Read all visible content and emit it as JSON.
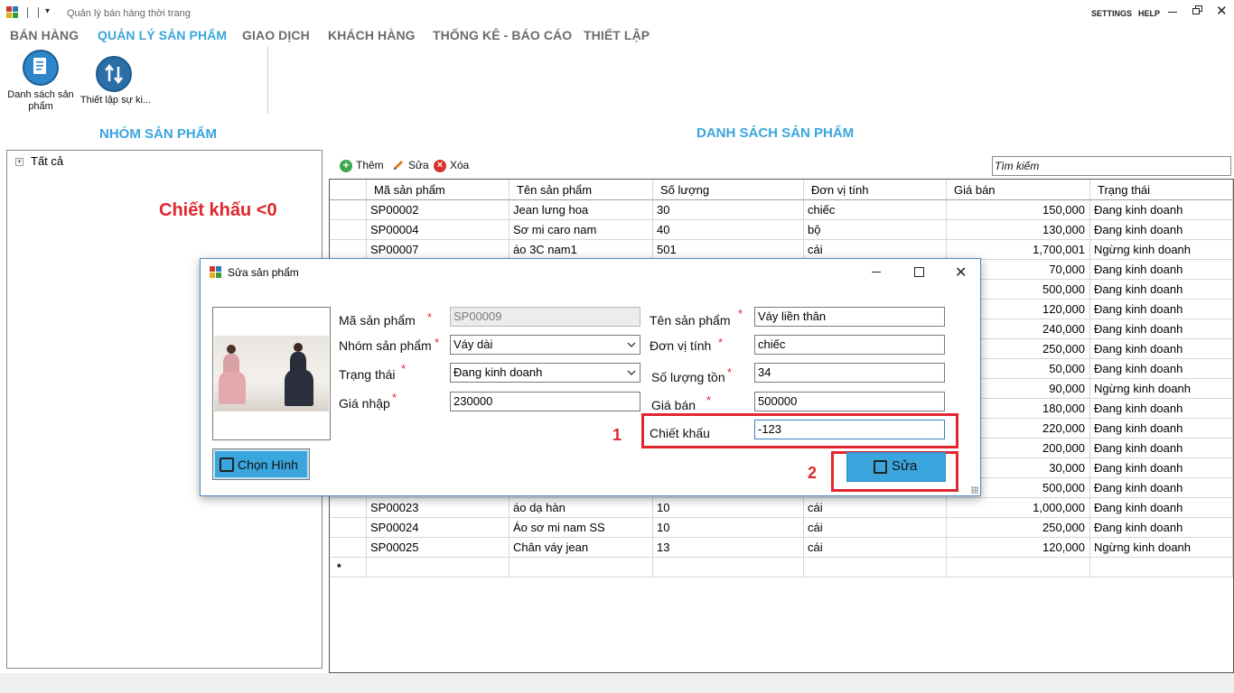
{
  "window": {
    "title": "Quản lý bán hàng thời trang",
    "settings": "SETTINGS",
    "help": "HELP",
    "close_glyph": "✕"
  },
  "tabs": [
    {
      "label": "BÁN HÀNG",
      "active": false
    },
    {
      "label": "QUẢN LÝ SẢN PHẨM",
      "active": true
    },
    {
      "label": "GIAO DỊCH",
      "active": false
    },
    {
      "label": "KHÁCH HÀNG",
      "active": false
    },
    {
      "label": "THỐNG KÊ - BÁO CÁO",
      "active": false
    },
    {
      "label": "THIẾT LẬP",
      "active": false
    }
  ],
  "ribbon": {
    "product_list": {
      "line1": "Danh sách sản",
      "line2": "phẩm",
      "icon": "document-list-icon"
    },
    "settings": {
      "label": "Thiết lập sự ki...",
      "icon": "transfer-icon"
    }
  },
  "left_panel": {
    "title": "NHÓM SẢN PHẨM",
    "tree_expander": "+",
    "tree_root": "Tất cả",
    "annotation": "Chiết khấu <0"
  },
  "right_panel": {
    "title": "DANH SÁCH SẢN PHẨM",
    "toolbar": {
      "add": "Thêm",
      "edit": "Sửa",
      "delete": "Xóa"
    },
    "search_value": "Tìm kiếm"
  },
  "grid": {
    "columns": [
      "Mã sản phẩm",
      "Tên sản phẩm",
      "Số lượng",
      "Đơn vị tính",
      "Giá bán",
      "Trạng thái"
    ],
    "new_row_marker": "*",
    "rows": [
      {
        "code": "SP00002",
        "name": "Jean lưng hoa",
        "qty": "30",
        "unit": "chiếc",
        "price": "150,000",
        "status": "Đang kinh doanh"
      },
      {
        "code": "SP00004",
        "name": "Sơ mi caro nam",
        "qty": "40",
        "unit": "bộ",
        "price": "130,000",
        "status": "Đang kinh doanh"
      },
      {
        "code": "SP00007",
        "name": "áo 3C nam1",
        "qty": "501",
        "unit": "cái",
        "price": "1,700,001",
        "status": "Ngừng kinh doanh"
      },
      {
        "code": "",
        "name": "",
        "qty": "",
        "unit": "",
        "price": "70,000",
        "status": "Đang kinh doanh"
      },
      {
        "code": "",
        "name": "",
        "qty": "",
        "unit": "",
        "price": "500,000",
        "status": "Đang kinh doanh"
      },
      {
        "code": "",
        "name": "",
        "qty": "",
        "unit": "",
        "price": "120,000",
        "status": "Đang kinh doanh"
      },
      {
        "code": "",
        "name": "",
        "qty": "",
        "unit": "",
        "price": "240,000",
        "status": "Đang kinh doanh"
      },
      {
        "code": "",
        "name": "",
        "qty": "",
        "unit": "",
        "price": "250,000",
        "status": "Đang kinh doanh"
      },
      {
        "code": "",
        "name": "",
        "qty": "",
        "unit": "",
        "price": "50,000",
        "status": "Đang kinh doanh"
      },
      {
        "code": "",
        "name": "",
        "qty": "",
        "unit": "",
        "price": "90,000",
        "status": "Ngừng kinh doanh"
      },
      {
        "code": "",
        "name": "",
        "qty": "",
        "unit": "",
        "price": "180,000",
        "status": "Đang kinh doanh"
      },
      {
        "code": "",
        "name": "",
        "qty": "",
        "unit": "",
        "price": "220,000",
        "status": "Đang kinh doanh"
      },
      {
        "code": "",
        "name": "",
        "qty": "",
        "unit": "",
        "price": "200,000",
        "status": "Đang kinh doanh"
      },
      {
        "code": "",
        "name": "",
        "qty": "",
        "unit": "",
        "price": "30,000",
        "status": "Đang kinh doanh"
      },
      {
        "code": "",
        "name": "",
        "qty": "",
        "unit": "",
        "price": "500,000",
        "status": "Đang kinh doanh"
      },
      {
        "code": "SP00023",
        "name": "áo dạ hàn",
        "qty": "10",
        "unit": "cái",
        "price": "1,000,000",
        "status": "Đang kinh doanh"
      },
      {
        "code": "SP00024",
        "name": "Áo sơ mi nam SS",
        "qty": "10",
        "unit": "cái",
        "price": "250,000",
        "status": "Đang kinh doanh"
      },
      {
        "code": "SP00025",
        "name": "Chân váy jean",
        "qty": "13",
        "unit": "cái",
        "price": "120,000",
        "status": "Ngừng kinh doanh"
      }
    ]
  },
  "dialog": {
    "title": "Sửa sản phẩm",
    "required_mark": "*",
    "labels": {
      "code": "Mã sản phẩm",
      "group": "Nhóm sản phẩm",
      "status": "Trạng thái",
      "cost": "Giá nhập",
      "name": "Tên sản phẩm",
      "unit": "Đơn vị tính",
      "stock": "Số lượng tồn",
      "price": "Giá bán",
      "discount": "Chiết khấu"
    },
    "values": {
      "code": "SP00009",
      "group": "Váy dài",
      "status": "Đang kinh doanh",
      "cost": "230000",
      "name": "Váy liền thân",
      "unit": "chiếc",
      "stock": "34",
      "price": "500000",
      "discount": "-123"
    },
    "choose_image": "Chọn Hình",
    "edit_button": "Sửa",
    "step1": "1",
    "step2": "2"
  },
  "colors": {
    "accent": "#3aa6dd",
    "annotation": "#e0262e"
  }
}
